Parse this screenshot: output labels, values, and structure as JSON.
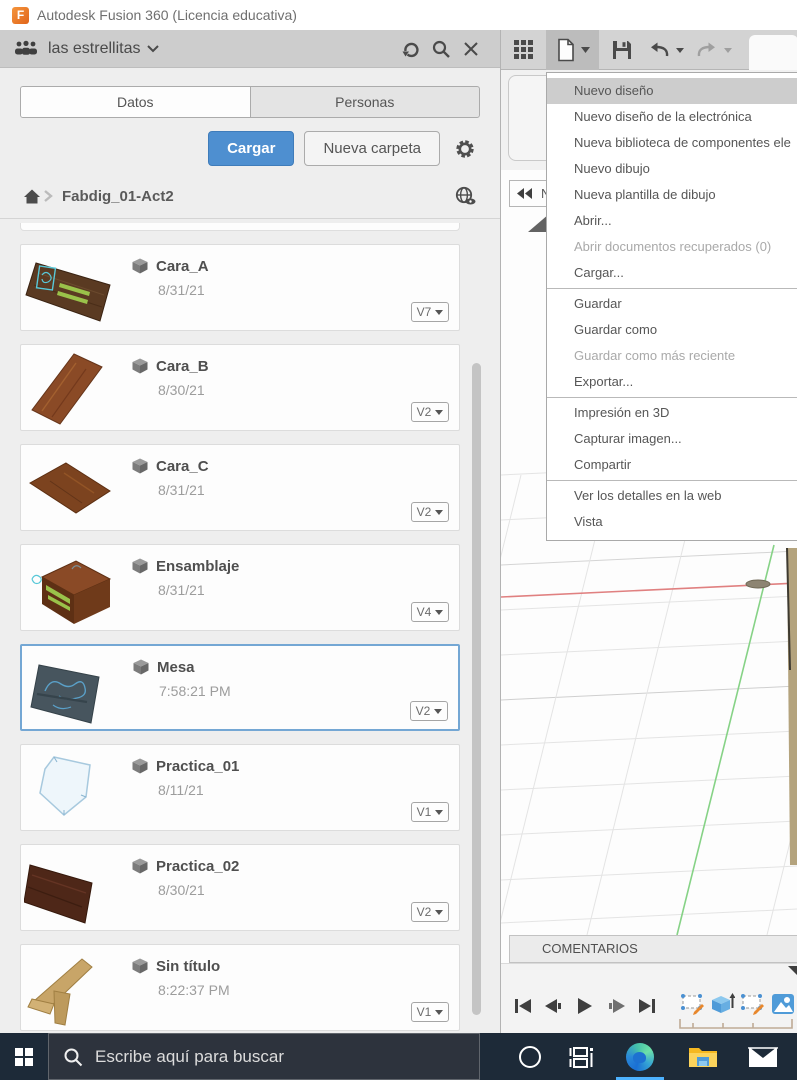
{
  "titlebar": {
    "app_title": "Autodesk Fusion 360 (Licencia educativa)"
  },
  "data_panel": {
    "team_name": "las estrellitas",
    "tabs": {
      "datos": "Datos",
      "personas": "Personas"
    },
    "buttons": {
      "upload": "Cargar",
      "new_folder": "Nueva carpeta"
    },
    "breadcrumb": {
      "folder": "Fabdig_01-Act2"
    },
    "items": [
      {
        "name": "Cara_A",
        "date": "8/31/21",
        "version": "V7",
        "selected": false,
        "thumb": "dark-wood-plank-with-sketch"
      },
      {
        "name": "Cara_B",
        "date": "8/30/21",
        "version": "V2",
        "selected": false,
        "thumb": "wood-plank"
      },
      {
        "name": "Cara_C",
        "date": "8/31/21",
        "version": "V2",
        "selected": false,
        "thumb": "flat-wood-panel"
      },
      {
        "name": "Ensamblaje",
        "date": "8/31/21",
        "version": "V4",
        "selected": false,
        "thumb": "wood-box"
      },
      {
        "name": "Mesa",
        "date": "7:58:21 PM",
        "version": "V2",
        "selected": true,
        "thumb": "slate-panel-sketch"
      },
      {
        "name": "Practica_01",
        "date": "8/11/21",
        "version": "V1",
        "selected": false,
        "thumb": "outline-sketch"
      },
      {
        "name": "Practica_02",
        "date": "8/30/21",
        "version": "V2",
        "selected": false,
        "thumb": "dark-wood-plank"
      },
      {
        "name": "Sin título",
        "date": "8:22:37 PM",
        "version": "V1",
        "selected": false,
        "thumb": "tan-table"
      }
    ]
  },
  "file_menu": {
    "items": [
      {
        "label": "Nuevo diseño",
        "highlighted": true
      },
      {
        "label": "Nuevo diseño de la electrónica"
      },
      {
        "label": "Nueva biblioteca de componentes ele"
      },
      {
        "label": "Nuevo dibujo"
      },
      {
        "label": "Nueva plantilla de dibujo"
      },
      {
        "label": "Abrir..."
      },
      {
        "label": "Abrir documentos recuperados (0)",
        "disabled": true
      },
      {
        "label": "Cargar...",
        "separator_after": true
      },
      {
        "label": "Guardar"
      },
      {
        "label": "Guardar como"
      },
      {
        "label": "Guardar como más reciente",
        "disabled": true
      },
      {
        "label": "Exportar...",
        "separator_after": true
      },
      {
        "label": "Impresión en 3D"
      },
      {
        "label": "Capturar imagen..."
      },
      {
        "label": "Compartir",
        "separator_after": true
      },
      {
        "label": "Ver los detalles en la web"
      },
      {
        "label": "Vista"
      }
    ]
  },
  "browser_panel": {
    "partial_label": "N"
  },
  "viewport": {
    "comments_label": "COMENTARIOS"
  },
  "taskbar": {
    "search_placeholder": "Escribe aquí para buscar"
  },
  "colors": {
    "accent_blue": "#4e8fd0",
    "selected_card_border": "#74a7d4",
    "axis_red": "#e08080",
    "axis_green": "#86d286",
    "taskbar_bg": "#1d2a38",
    "edge_underline": "#4db2ff"
  }
}
